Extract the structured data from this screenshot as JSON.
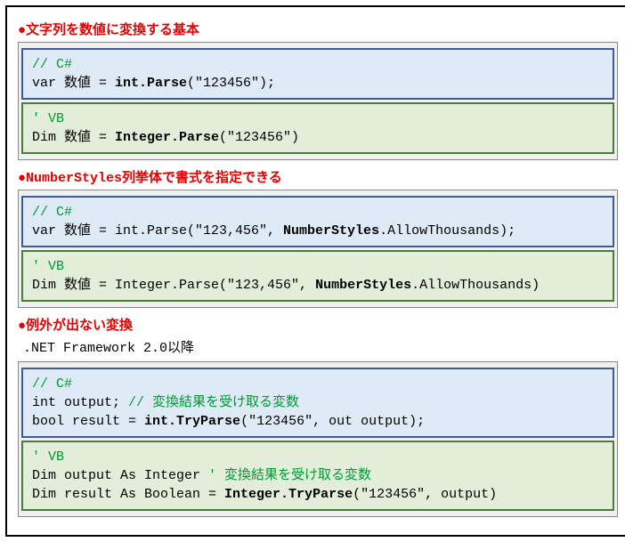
{
  "sections": [
    {
      "title": "●文字列を数値に変換する基本",
      "subtitle": null,
      "blocks": [
        {
          "lang": "csharp",
          "lines": [
            {
              "segments": [
                {
                  "t": "// C#",
                  "cls": "comment"
                }
              ]
            },
            {
              "segments": [
                {
                  "t": "var 数値 = "
                },
                {
                  "t": "int.Parse",
                  "cls": "bold"
                },
                {
                  "t": "(\"123456\");"
                }
              ]
            }
          ]
        },
        {
          "lang": "vb",
          "lines": [
            {
              "segments": [
                {
                  "t": "' VB",
                  "cls": "comment"
                }
              ]
            },
            {
              "segments": [
                {
                  "t": "Dim 数値 = "
                },
                {
                  "t": "Integer.Parse",
                  "cls": "bold"
                },
                {
                  "t": "(\"123456\")"
                }
              ]
            }
          ]
        }
      ]
    },
    {
      "title": "●NumberStyles列挙体で書式を指定できる",
      "subtitle": null,
      "blocks": [
        {
          "lang": "csharp",
          "lines": [
            {
              "segments": [
                {
                  "t": "// C#",
                  "cls": "comment"
                }
              ]
            },
            {
              "segments": [
                {
                  "t": "var 数値 = int.Parse(\"123,456\", "
                },
                {
                  "t": "NumberStyles",
                  "cls": "bold"
                },
                {
                  "t": ".AllowThousands);"
                }
              ]
            }
          ]
        },
        {
          "lang": "vb",
          "lines": [
            {
              "segments": [
                {
                  "t": "' VB",
                  "cls": "comment"
                }
              ]
            },
            {
              "segments": [
                {
                  "t": "Dim 数値 = Integer.Parse(\"123,456\", "
                },
                {
                  "t": "NumberStyles",
                  "cls": "bold"
                },
                {
                  "t": ".AllowThousands)"
                }
              ]
            }
          ]
        }
      ]
    },
    {
      "title": "●例外が出ない変換",
      "subtitle": ".NET Framework 2.0以降",
      "blocks": [
        {
          "lang": "csharp",
          "lines": [
            {
              "segments": [
                {
                  "t": "// C#",
                  "cls": "comment"
                }
              ]
            },
            {
              "segments": [
                {
                  "t": "int output; "
                },
                {
                  "t": "// 変換結果を受け取る変数",
                  "cls": "comment"
                }
              ]
            },
            {
              "segments": [
                {
                  "t": "bool result = "
                },
                {
                  "t": "int.TryParse",
                  "cls": "bold"
                },
                {
                  "t": "(\"123456\", out output);"
                }
              ]
            }
          ]
        },
        {
          "lang": "vb",
          "lines": [
            {
              "segments": [
                {
                  "t": "' VB",
                  "cls": "comment"
                }
              ]
            },
            {
              "segments": [
                {
                  "t": "Dim output As Integer "
                },
                {
                  "t": "' 変換結果を受け取る変数",
                  "cls": "comment"
                }
              ]
            },
            {
              "segments": [
                {
                  "t": "Dim result As Boolean = "
                },
                {
                  "t": "Integer.TryParse",
                  "cls": "bold"
                },
                {
                  "t": "(\"123456\", output)"
                }
              ]
            }
          ]
        }
      ]
    }
  ]
}
